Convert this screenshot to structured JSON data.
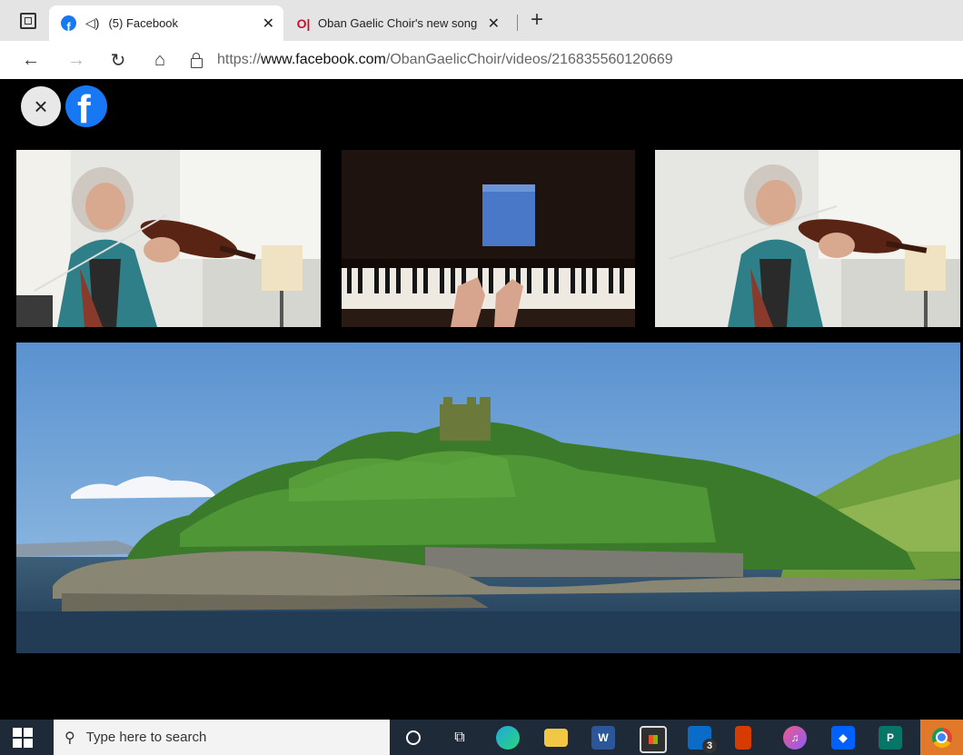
{
  "browser": {
    "tabs": [
      {
        "title": "(5) Facebook",
        "active": true,
        "muted_icon": "speaker-icon"
      },
      {
        "title": "Oban Gaelic Choir's new song hi",
        "active": false
      }
    ],
    "new_tab_label": "+",
    "url": {
      "prefix": "https://",
      "host": "www.facebook.com",
      "path": "/ObanGaelicChoir/videos/216835560120669"
    }
  },
  "viewer": {
    "close_label": "×",
    "logo_letter": "f"
  },
  "taskbar": {
    "search_placeholder": "Type here to search",
    "mail_badge": "3",
    "word_label": "W",
    "publisher_label": "P"
  },
  "colors": {
    "facebook_blue": "#1877f2",
    "taskbar": "#1f2a38",
    "tabstrip": "#e4e4e4"
  }
}
